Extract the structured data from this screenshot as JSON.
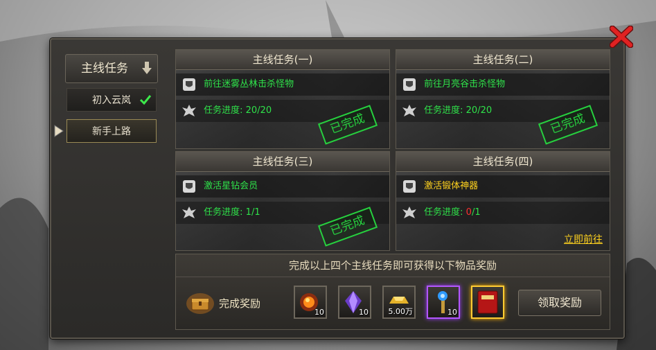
{
  "sidebar": {
    "title": "主线任务",
    "items": [
      {
        "label": "初入云岚",
        "completed": true
      },
      {
        "label": "新手上路",
        "selected": true
      }
    ]
  },
  "quests": [
    {
      "title": "主线任务(一)",
      "goal": "前往迷雾丛林击杀怪物",
      "progress_label": "任务进度: ",
      "progress_current": "20",
      "progress_total": "/20",
      "status": "已完成"
    },
    {
      "title": "主线任务(二)",
      "goal": "前往月亮谷击杀怪物",
      "progress_label": "任务进度: ",
      "progress_current": "20",
      "progress_total": "/20",
      "status": "已完成"
    },
    {
      "title": "主线任务(三)",
      "goal": "激活星钻会员",
      "progress_label": "任务进度: ",
      "progress_current": "1",
      "progress_total": "/1",
      "status": "已完成"
    },
    {
      "title": "主线任务(四)",
      "goal": "激活锻体神器",
      "progress_label": "任务进度: ",
      "progress_current": "0",
      "progress_total": "/1",
      "goto": "立即前往"
    }
  ],
  "reward": {
    "description": "完成以上四个主线任务即可获得以下物品奖励",
    "label": "完成奖励",
    "items": [
      {
        "icon": "fire-orb-icon",
        "count": "10"
      },
      {
        "icon": "purple-crystal-icon",
        "count": "10"
      },
      {
        "icon": "gold-ingot-icon",
        "count": "5.00万"
      },
      {
        "icon": "magic-scepter-icon",
        "count": "10"
      },
      {
        "icon": "red-book-icon",
        "count": ""
      }
    ],
    "claim_label": "领取奖励"
  },
  "colors": {
    "complete_green": "#27d03f",
    "progress_green": "#2fe24a",
    "incomplete_red": "#ff3030",
    "link_yellow": "#ffd21e"
  }
}
